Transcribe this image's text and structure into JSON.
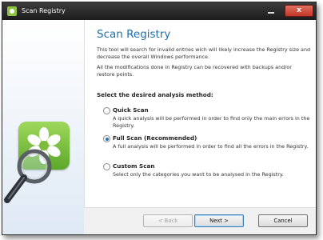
{
  "window": {
    "title": "Scan Registry",
    "close_glyph": "x"
  },
  "main": {
    "heading": "Scan Registry",
    "intro": "This tool will search for invalid entries wich will likely increase the Registry size and decrease the overall Windows performance.",
    "note": "All the modifications done in Registry can be recovered with backups and/or restore points.",
    "method_label": "Select the desired analysis method:",
    "options": [
      {
        "title": "Quick Scan",
        "description": "A quick analysis will be performed in order to find only the main errors in the Registry.",
        "selected": false
      },
      {
        "title": "Full Scan (Recommended)",
        "description": "A full analysis will be performed in order to find all the errors in the Registry.",
        "selected": true
      },
      {
        "title": "Custom Scan",
        "description": "Select only the categories you want to be analysed in the Registry.",
        "selected": false
      }
    ]
  },
  "footer": {
    "back_label": "< Back",
    "next_label": "Next >",
    "cancel_label": "Cancel"
  },
  "colors": {
    "accent": "#1e6ea8",
    "logo_green": "#8cc63f"
  }
}
